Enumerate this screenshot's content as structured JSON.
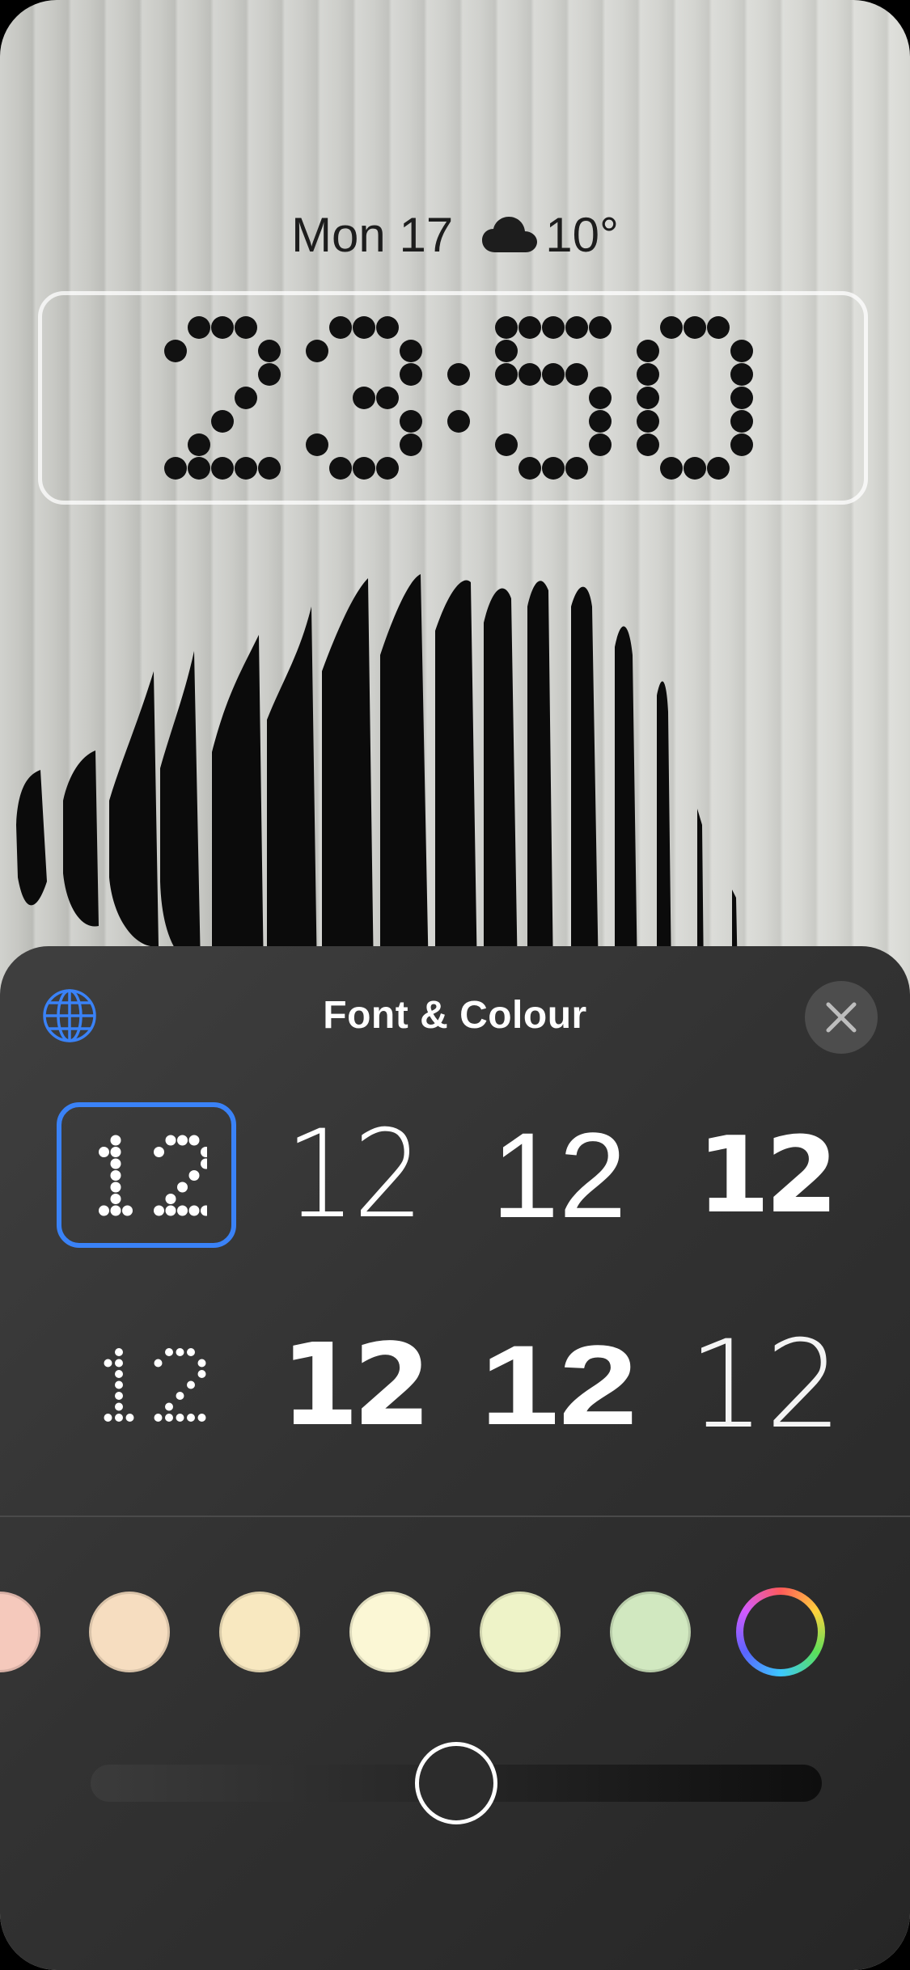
{
  "lock_screen": {
    "date": "Mon 17",
    "weather_icon": "cloud-icon",
    "temperature": "10°",
    "time": "23:50"
  },
  "sheet": {
    "title": "Font & Colour",
    "globe_icon": "globe-icon",
    "close_icon": "close-icon",
    "font_sample": "12",
    "selected_font_index": 0,
    "fonts": [
      "dot-matrix",
      "thin-rounded",
      "regular",
      "heavy-rounded",
      "dot-grid",
      "heavy-stencil",
      "extra-wide",
      "ultra-thin"
    ]
  },
  "colours": {
    "swatches": [
      "#f5c9bc",
      "#f6ddc0",
      "#f8e8c0",
      "#fbf7d5",
      "#eef3c8",
      "#d1e8c0"
    ],
    "custom_icon": "colour-wheel-icon",
    "accent": "#3a82f7"
  },
  "slider": {
    "value": 0.5
  }
}
